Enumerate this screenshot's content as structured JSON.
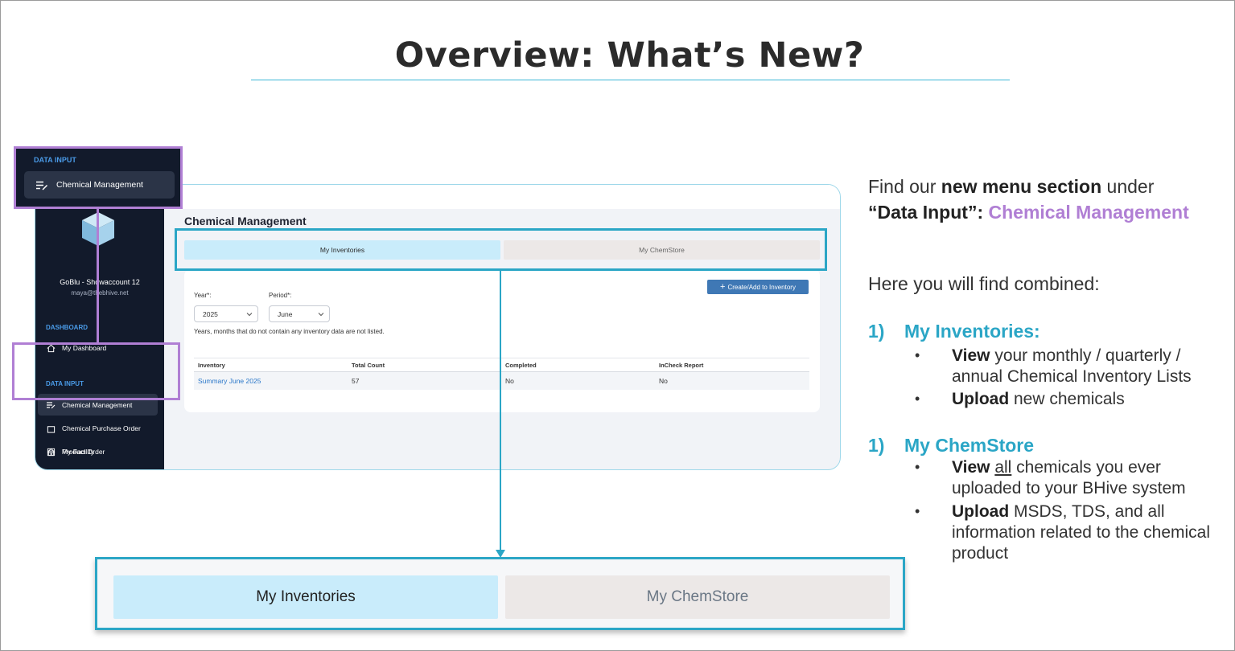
{
  "slide": {
    "title": "Overview: What’s New?"
  },
  "app": {
    "sidebar": {
      "account_name": "GoBlu - Showaccount 12",
      "account_email": "maya@thebhive.net",
      "sections": [
        {
          "heading": "DASHBOARD",
          "items": [
            {
              "label": "My Dashboard",
              "icon": "home-icon"
            }
          ]
        },
        {
          "heading": "DATA INPUT",
          "items": [
            {
              "label": "Chemical Management",
              "icon": "list-edit-icon"
            },
            {
              "label": "Chemical Purchase Order",
              "icon": "box-icon"
            },
            {
              "label": "My Facility",
              "icon": "home-icon"
            },
            {
              "label": "Product Order",
              "icon": "grid-icon"
            }
          ]
        }
      ]
    },
    "page_title": "Chemical Management",
    "tabs": [
      {
        "label": "My Inventories",
        "active": true
      },
      {
        "label": "My ChemStore",
        "active": false
      }
    ],
    "create_button": "Create/Add to Inventory",
    "filters": {
      "year_label": "Year*:",
      "year_value": "2025",
      "period_label": "Period*:",
      "period_value": "June",
      "note": "Years, months that do not contain any inventory data are not listed."
    },
    "table": {
      "headers": [
        "Inventory",
        "Total Count",
        "Completed",
        "InCheck Report"
      ],
      "rows": [
        [
          "Summary June 2025",
          "57",
          "No",
          "No"
        ]
      ]
    }
  },
  "zoom": {
    "sidebar_heading": "DATA INPUT",
    "sidebar_item": "Chemical Management",
    "tabs": [
      "My Inventories",
      "My ChemStore"
    ]
  },
  "notes": {
    "intro_prefix": "Find our ",
    "intro_bold": "new menu section",
    "intro_suffix": " under",
    "intro_line2_bold": "“Data Input”:",
    "intro_line2_highlight": "Chemical Management",
    "combined": "Here you will find combined:",
    "sections": [
      {
        "number": "1)",
        "title": "My Inventories:",
        "bullets": [
          {
            "bold": "View",
            "text_line1": " your monthly / quarterly /",
            "text_line2": "annual Chemical Inventory Lists"
          },
          {
            "bold": "Upload",
            "text_line1": " new chemicals"
          }
        ]
      },
      {
        "number": "1)",
        "title": "My ChemStore",
        "bullets": [
          {
            "bold": "View",
            "underlined": "all",
            "text_line1": " chemicals you ever",
            "text_line2": "uploaded to your BHive system"
          },
          {
            "bold": "Upload",
            "text_line1": " MSDS, TDS, and all",
            "text_line2": "information related to the chemical",
            "text_line3": "product"
          }
        ]
      }
    ]
  },
  "colors": {
    "accent_teal": "#2ba6c6",
    "accent_purple": "#b07fd4",
    "sidebar_bg": "#121a2b",
    "tab_active": "#c9ecfb",
    "button_blue": "#3f78b5"
  }
}
